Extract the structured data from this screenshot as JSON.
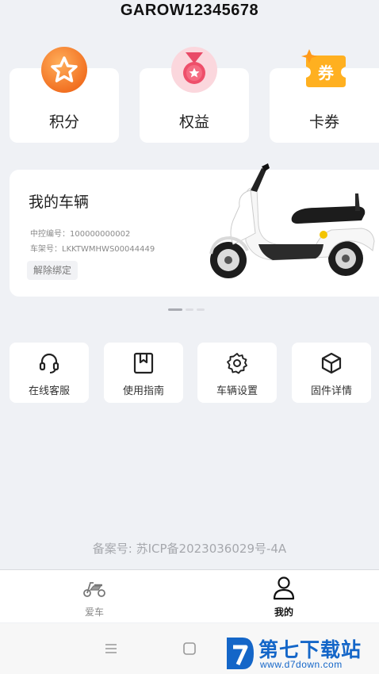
{
  "header": {
    "title": "GAROW12345678"
  },
  "perks": [
    {
      "label": "积分",
      "icon": "points-star-icon"
    },
    {
      "label": "权益",
      "icon": "rights-medal-icon"
    },
    {
      "label": "卡券",
      "icon": "coupon-icon",
      "icon_text": "券"
    }
  ],
  "vehicle": {
    "title": "我的车辆",
    "controller": "中控编号：100000000002",
    "frame": "车架号：LKKTWMHWS00044449",
    "unbind_label": "解除绑定",
    "carousel_active_index": 0,
    "carousel_count": 3
  },
  "tools": [
    {
      "label": "在线客服",
      "icon": "headset-icon"
    },
    {
      "label": "使用指南",
      "icon": "guide-book-icon"
    },
    {
      "label": "车辆设置",
      "icon": "gear-icon"
    },
    {
      "label": "固件详情",
      "icon": "package-cube-icon"
    }
  ],
  "footer": {
    "icp": "备案号: 苏ICP备2023036029号-4A"
  },
  "tabs": [
    {
      "label": "爱车",
      "icon": "scooter-icon",
      "active": false
    },
    {
      "label": "我的",
      "icon": "user-icon",
      "active": true
    }
  ],
  "watermark": {
    "title": "第七下载站",
    "url": "www.d7down.com"
  },
  "colors": {
    "accent_orange": "#f5821f",
    "tab_active": "#111111",
    "tab_inactive": "#888888",
    "watermark_blue": "#1466c8"
  }
}
